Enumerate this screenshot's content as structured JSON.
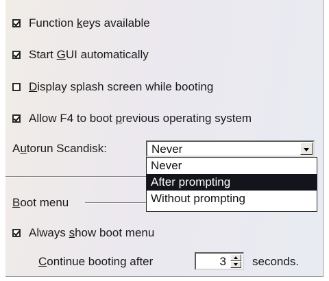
{
  "options": {
    "function_keys": {
      "pre": "Function ",
      "acc": "k",
      "post": "eys available",
      "checked": true
    },
    "start_gui": {
      "pre": "Start ",
      "acc": "G",
      "post": "UI automatically",
      "checked": true
    },
    "splash": {
      "pre": "",
      "acc": "D",
      "post": "isplay splash screen while booting",
      "checked": false
    },
    "allow_f4": {
      "pre": "Allow F4 to boot ",
      "acc": "p",
      "post": "revious operating system",
      "checked": true
    }
  },
  "autorun": {
    "label_pre": "A",
    "label_acc": "u",
    "label_post": "torun Scandisk:",
    "selected": "Never",
    "options": [
      "Never",
      "After prompting",
      "Without prompting"
    ],
    "highlighted_index": 1
  },
  "boot_menu": {
    "title_acc": "B",
    "title_post": "oot menu",
    "always_show": {
      "pre": "Always ",
      "acc": "s",
      "post": "how boot menu",
      "checked": true
    },
    "continue": {
      "acc": "C",
      "post": "ontinue booting after",
      "value": "3",
      "unit": "seconds."
    }
  }
}
